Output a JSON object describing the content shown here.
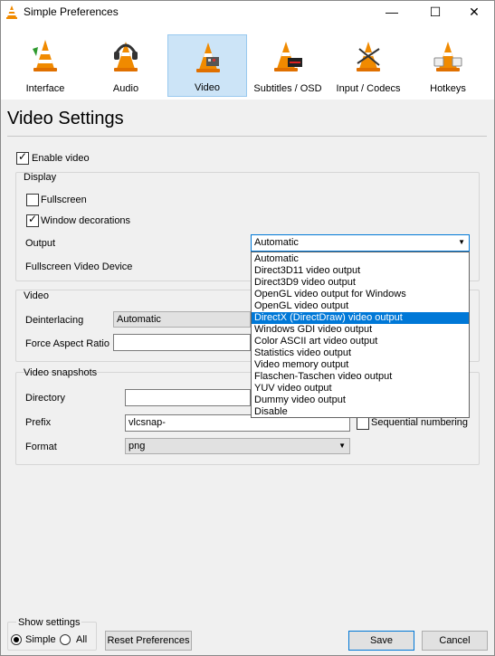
{
  "window": {
    "title": "Simple Preferences",
    "minimize": "—",
    "maximize": "☐",
    "close": "✕"
  },
  "toolbar": {
    "items": [
      {
        "label": "Interface",
        "icon": "cone-icon"
      },
      {
        "label": "Audio",
        "icon": "cone-headphones-icon"
      },
      {
        "label": "Video",
        "icon": "cone-video-icon"
      },
      {
        "label": "Subtitles / OSD",
        "icon": "cone-subtitles-icon"
      },
      {
        "label": "Input / Codecs",
        "icon": "cone-input-icon"
      },
      {
        "label": "Hotkeys",
        "icon": "cone-hotkeys-icon"
      }
    ],
    "selected": "Video"
  },
  "page": {
    "heading": "Video Settings",
    "enable_video": {
      "label": "Enable video",
      "checked": true
    }
  },
  "display": {
    "title": "Display",
    "fullscreen": {
      "label": "Fullscreen",
      "checked": false
    },
    "window_decorations": {
      "label": "Window decorations",
      "checked": true
    },
    "output_label": "Output",
    "output_value": "Automatic",
    "fullscreen_device_label": "Fullscreen Video Device"
  },
  "output_options": [
    "Automatic",
    "Direct3D11 video output",
    "Direct3D9 video output",
    "OpenGL video output for Windows",
    "OpenGL video output",
    "DirectX (DirectDraw) video output",
    "Windows GDI video output",
    "Color ASCII art video output",
    "Statistics video output",
    "Video memory output",
    "Flaschen-Taschen video output",
    "YUV video output",
    "Dummy video output",
    "Disable"
  ],
  "output_highlighted": "DirectX (DirectDraw) video output",
  "video": {
    "title": "Video",
    "deinterlacing_label": "Deinterlacing",
    "deinterlacing_value": "Automatic",
    "aspect_label": "Force Aspect Ratio",
    "aspect_value": ""
  },
  "snapshots": {
    "title": "Video snapshots",
    "directory_label": "Directory",
    "directory_value": "",
    "prefix_label": "Prefix",
    "prefix_value": "vlcsnap-",
    "sequential_label": "Sequential numbering",
    "sequential_checked": false,
    "format_label": "Format",
    "format_value": "png"
  },
  "footer": {
    "show_settings_label": "Show settings",
    "simple_label": "Simple",
    "all_label": "All",
    "simple_checked": true,
    "reset_label": "Reset Preferences",
    "save_label": "Save",
    "cancel_label": "Cancel"
  },
  "colors": {
    "accent": "#0078d7",
    "selected_tab": "#cce4f7",
    "cone_orange": "#f08a00"
  }
}
